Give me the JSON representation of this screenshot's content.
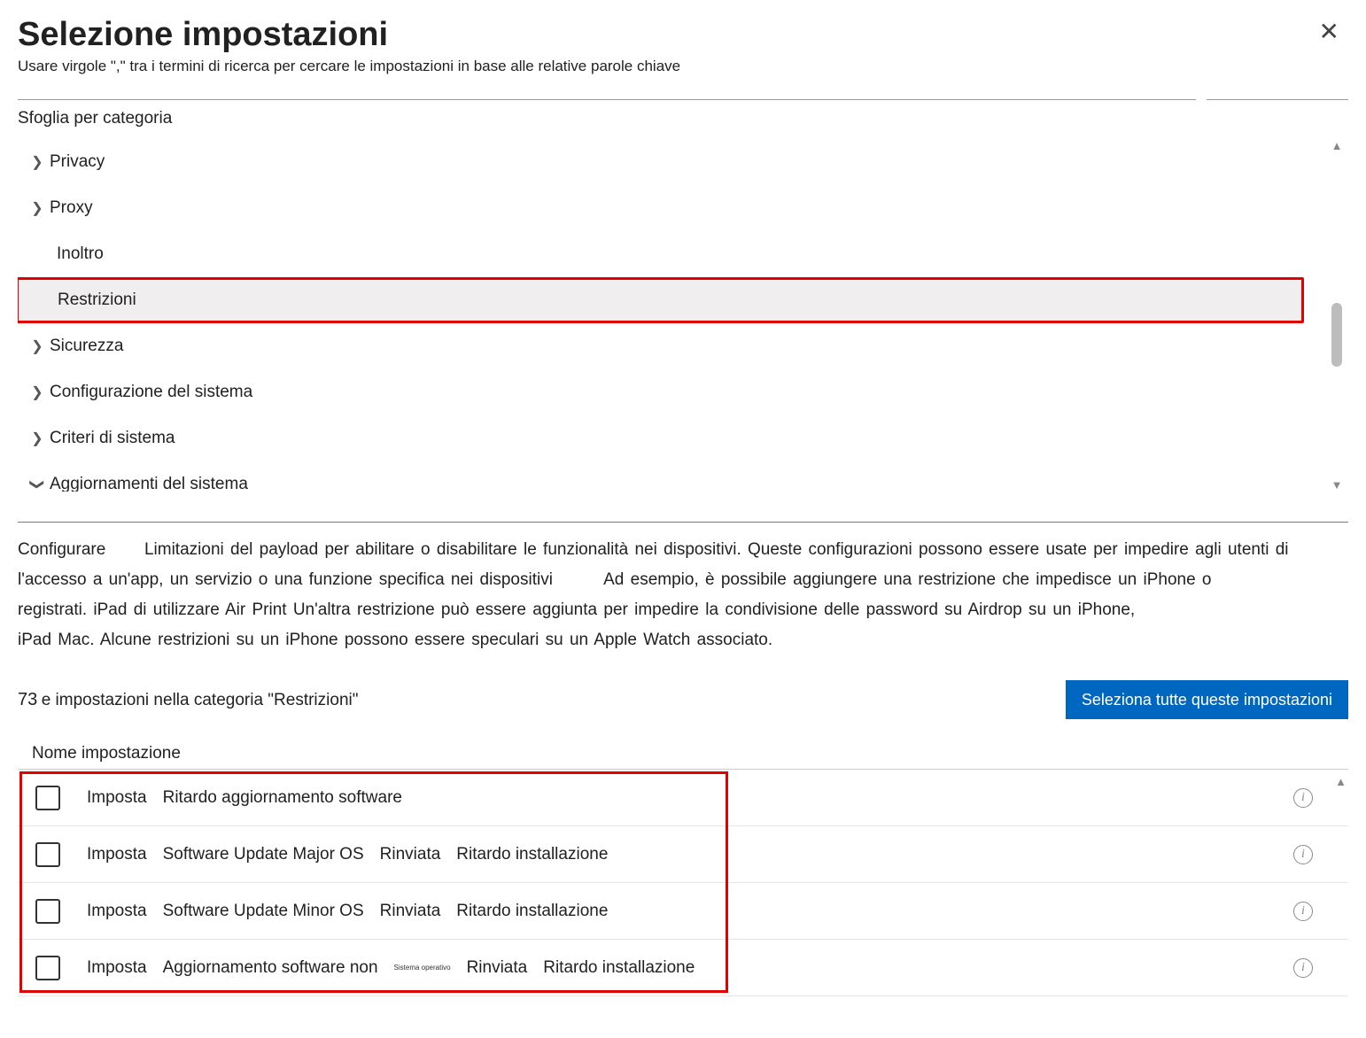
{
  "header": {
    "title": "Selezione impostazioni",
    "subtitle": "Usare virgole    \",\"  tra i termini di ricerca per cercare le impostazioni in base alle relative parole chiave"
  },
  "browse_label": "Sfoglia per categoria",
  "categories": {
    "privacy": "Privacy",
    "proxy": "Proxy",
    "inoltro": "Inoltro",
    "restrizioni": "Restrizioni",
    "sicurezza": "Sicurezza",
    "config_sistema": "Configurazione del sistema",
    "criteri_sistema": "Criteri di sistema",
    "aggiornamenti": "Aggiornamenti del sistema"
  },
  "description": {
    "p1a": "Configurare",
    "p1b": "Limitazioni del payload per abilitare o disabilitare le funzionalità nei dispositivi. Queste configurazioni possono essere usate per impedire agli utenti di",
    "p2a": "l'accesso a un'app, un servizio o una funzione specifica nei dispositivi",
    "p2b": "Ad esempio, è possibile aggiungere una restrizione che impedisce un iPhone o",
    "p3": "registrati. iPad di utilizzare Air Print Un'altra restrizione può essere aggiunta per impedire la condivisione delle password su Airdrop su un iPhone,",
    "p4": "iPad Mac. Alcune restrizioni su un iPhone possono essere speculari su un Apple Watch associato."
  },
  "count": {
    "num": "73",
    "text": "e impostazioni nella categoria \"Restrizioni\""
  },
  "select_all_label": "Seleziona tutte queste impostazioni",
  "column_header": "Nome impostazione",
  "common": {
    "action": "Imposta",
    "deferred": "Rinviata",
    "install_delay": "Ritardo installazione",
    "tiny_os": "Sistema operativo"
  },
  "rows": [
    {
      "name": "Ritardo aggiornamento software",
      "extra": ""
    },
    {
      "name": "Software Update Major OS",
      "extra": "deferred_install"
    },
    {
      "name": "Software Update Minor OS",
      "extra": "deferred_install"
    },
    {
      "name": "Aggiornamento software non",
      "extra": "tiny_deferred_install"
    }
  ]
}
